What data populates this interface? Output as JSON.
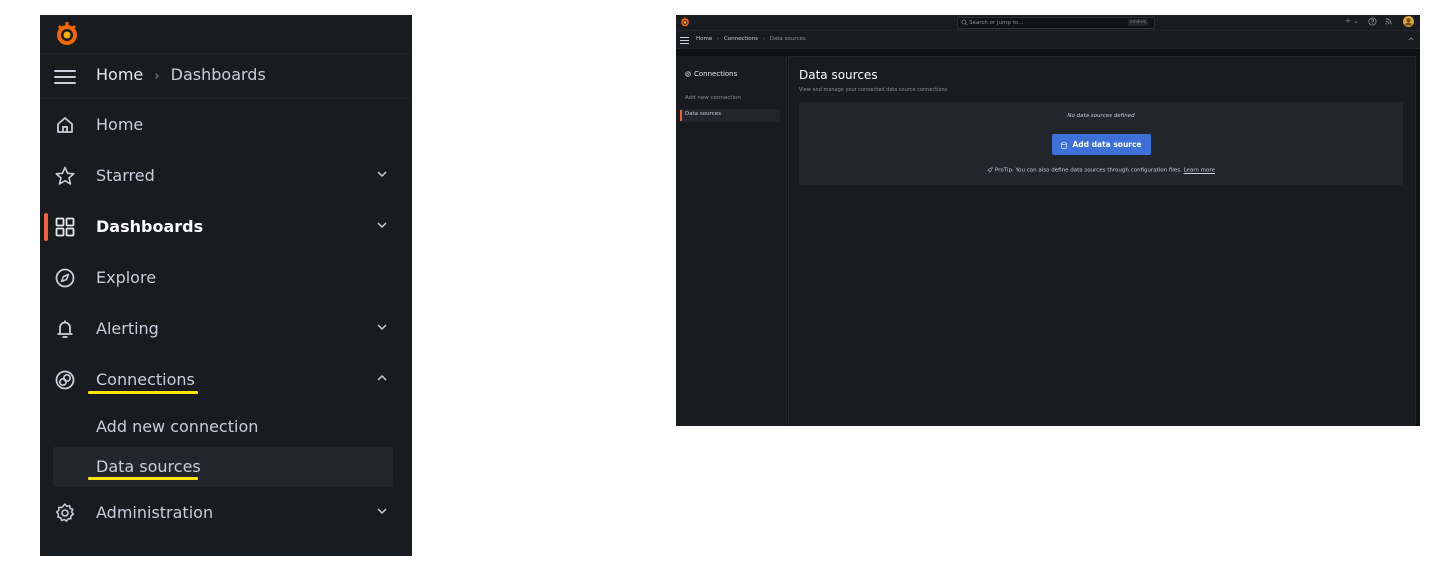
{
  "left_panel": {
    "breadcrumb": {
      "home": "Home",
      "separator": "›",
      "current": "Dashboards"
    },
    "nav_items": [
      {
        "label": "Home",
        "icon": "home-icon"
      },
      {
        "label": "Starred",
        "icon": "star-icon"
      },
      {
        "label": "Dashboards",
        "icon": "apps-icon"
      },
      {
        "label": "Explore",
        "icon": "compass-icon"
      },
      {
        "label": "Alerting",
        "icon": "bell-icon"
      },
      {
        "label": "Connections",
        "icon": "connections-icon"
      },
      {
        "label": "Administration",
        "icon": "cog-icon"
      }
    ],
    "sub_items": [
      {
        "label": "Add new connection"
      },
      {
        "label": "Data sources"
      }
    ]
  },
  "right_panel": {
    "search": {
      "placeholder": "Search or jump to...",
      "shortcut": "cmd+k"
    },
    "topbar_actions": {
      "plus": "+ ⌄"
    },
    "breadcrumb": {
      "home": "Home",
      "separator": "›",
      "middle": "Connections",
      "current": "Data sources"
    },
    "sidebar": {
      "title": "Connections",
      "items": [
        {
          "label": "Add new connection"
        },
        {
          "label": "Data sources"
        }
      ]
    },
    "page": {
      "title": "Data sources",
      "subtitle": "View and manage your connected data source connections",
      "empty_text": "No data sources defined",
      "add_button": "Add data source",
      "protip": "ProTip: You can also define data sources through configuration files.",
      "learn_more": "Learn more"
    }
  },
  "colors": {
    "background": "#181b1f",
    "canvas": "#111217",
    "accent_orange": "#f55f3e",
    "primary_button": "#3d71d9",
    "highlight_underline": "#ffe600"
  }
}
